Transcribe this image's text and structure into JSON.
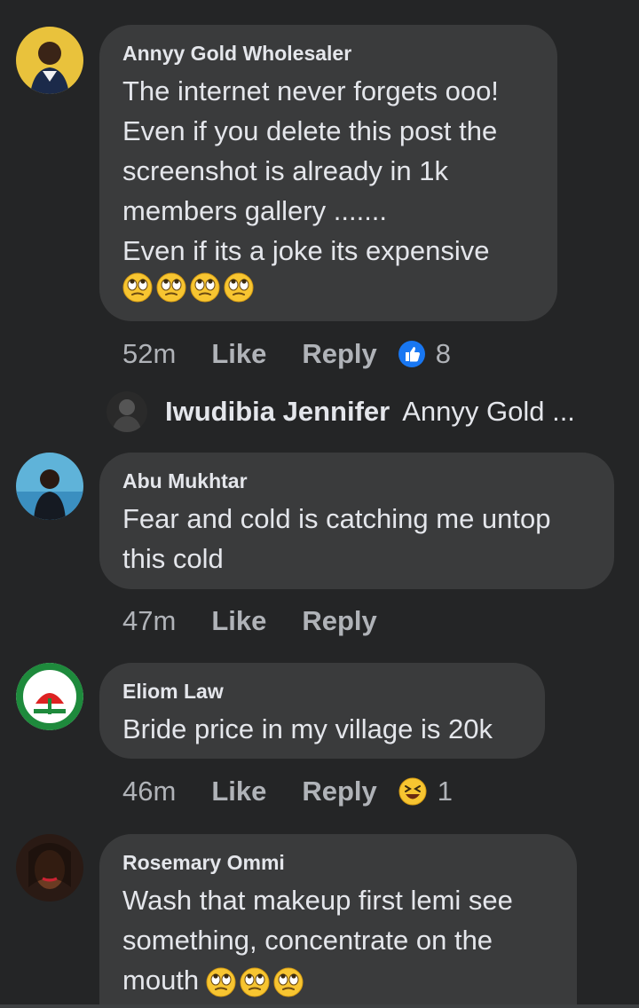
{
  "comments": [
    {
      "author": "Annyy Gold Wholesaler",
      "text": "The internet never forgets ooo!\nEven if you delete this post the\nscreenshot is already in 1k\nmembers gallery .......\nEven if its a joke its expensive",
      "time": "52m",
      "like_label": "Like",
      "reply_label": "Reply",
      "reaction_count": "8"
    },
    {
      "author": "Abu Mukhtar",
      "text": "Fear and cold is catching me untop\nthis cold",
      "time": "47m",
      "like_label": "Like",
      "reply_label": "Reply"
    },
    {
      "author": "Eliom Law",
      "text": "Bride price in my village is 20k",
      "time": "46m",
      "like_label": "Like",
      "reply_label": "Reply",
      "reaction_count": "1"
    },
    {
      "author": "Rosemary Ommi",
      "text": "Wash that makeup first lemi see\nsomething, concentrate on the\nmouth"
    }
  ],
  "reply_preview": {
    "author": "Iwudibia Jennifer",
    "text": "Annyy Gold ..."
  },
  "icons": {
    "rolling_eyes": "face-with-rolling-eyes-icon",
    "like_reaction": "like-thumb-icon",
    "laugh_reaction": "laughing-face-icon"
  },
  "colors": {
    "background": "#242526",
    "bubble": "#3a3b3c",
    "text": "#e4e6eb",
    "meta": "#b0b3b8",
    "like_blue": "#1877f2"
  }
}
